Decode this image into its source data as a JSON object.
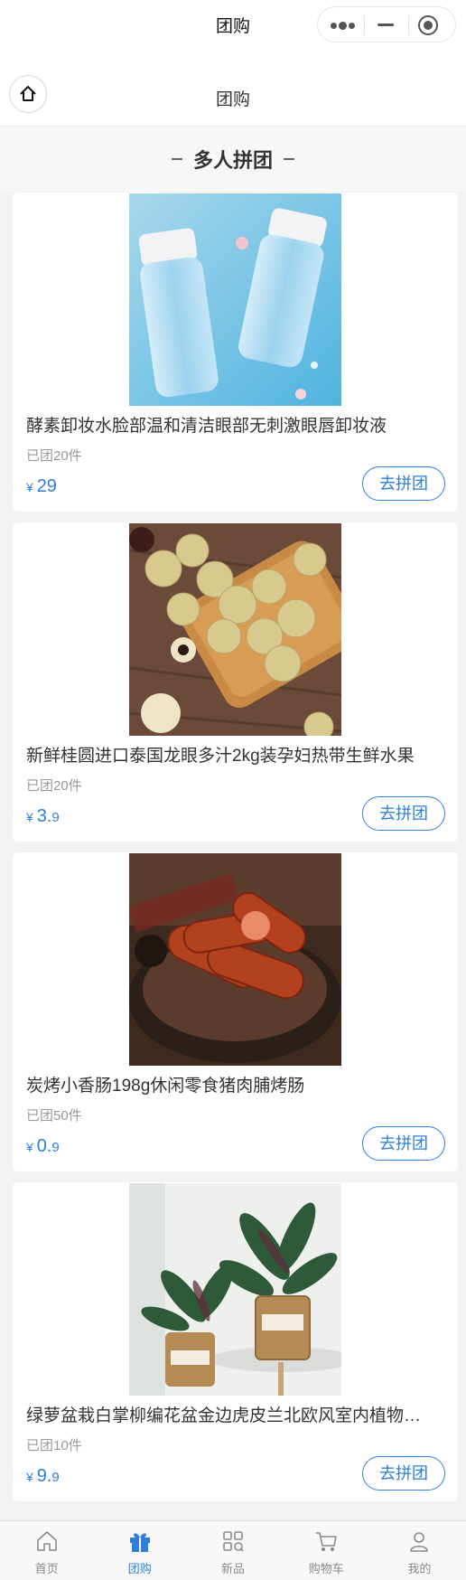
{
  "navbar": {
    "title": "团购"
  },
  "header": {
    "title": "团购"
  },
  "section": {
    "title": "多人拼团"
  },
  "products": [
    {
      "name": "酵素卸妆水脸部温和清洁眼部无刺激眼唇卸妆液",
      "sold": "已团20件",
      "currency": "¥",
      "price_int": "29",
      "price_dec": "",
      "button": "去拼团"
    },
    {
      "name": "新鲜桂圆进口泰国龙眼多汁2kg装孕妇热带生鲜水果",
      "sold": "已团20件",
      "currency": "¥",
      "price_int": "3.",
      "price_dec": "9",
      "button": "去拼团"
    },
    {
      "name": "炭烤小香肠198g休闲零食猪肉脯烤肠",
      "sold": "已团50件",
      "currency": "¥",
      "price_int": "0.",
      "price_dec": "9",
      "button": "去拼团"
    },
    {
      "name": "绿萝盆栽白掌柳编花盆金边虎皮兰北欧风室内植物…",
      "sold": "已团10件",
      "currency": "¥",
      "price_int": "9.",
      "price_dec": "9",
      "button": "去拼团"
    }
  ],
  "tabbar": [
    {
      "label": "首页",
      "icon": "home-icon"
    },
    {
      "label": "团购",
      "icon": "gift-icon",
      "active": true
    },
    {
      "label": "新品",
      "icon": "grid-icon"
    },
    {
      "label": "购物车",
      "icon": "cart-icon"
    },
    {
      "label": "我的",
      "icon": "user-icon"
    }
  ],
  "colors": {
    "accent": "#2f7fd9",
    "text": "#333333",
    "muted": "#999999"
  }
}
